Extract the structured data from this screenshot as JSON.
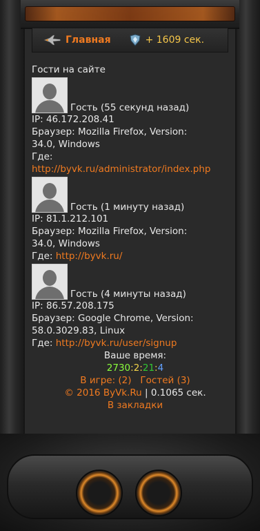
{
  "nav": {
    "home_label": "Главная",
    "bonus_label": "+ 1609 сек.",
    "home_icon": "fighter-jet-icon",
    "bonus_icon": "shield-gem-icon"
  },
  "guests": {
    "heading": "Гости на сайте",
    "items": [
      {
        "name": "Гость (55 секунд назад)",
        "ip": "IP: 46.172.208.41",
        "browser_1": "Браузер: Mozilla Firefox, Version:",
        "browser_2": "34.0, Windows",
        "where_label": "Где:",
        "where_link": "http://byvk.ru/administrator/index.php"
      },
      {
        "name": "Гость (1 минуту назад)",
        "ip": "IP: 81.1.212.101",
        "browser_1": "Браузер: Mozilla Firefox, Version:",
        "browser_2": "34.0, Windows",
        "where_label": "Где:",
        "where_link": "http://byvk.ru/"
      },
      {
        "name": "Гость (4 минуты назад)",
        "ip": "IP: 86.57.208.175",
        "browser_1": "Браузер: Google Chrome, Version:",
        "browser_2": "58.0.3029.83, Linux",
        "where_label": "Где:",
        "where_link": "http://byvk.ru/user/signup"
      }
    ]
  },
  "footer": {
    "your_time_label": "Ваше время:",
    "time": {
      "a": "2730",
      "sep1": ":",
      "b": "2",
      "sep2": ":",
      "c": "21",
      "sep3": ":",
      "d": "4"
    },
    "in_game": "В игре: (2)",
    "guests_count": "Гостей (3)",
    "copyright": "© 2016 ByVk.Ru",
    "separator": "|",
    "gen_time": "0.1065 сек.",
    "bookmarks": "В закладки"
  },
  "colors": {
    "accent": "#f07a20",
    "bonus": "#f5c64a",
    "background": "#2a2a2a"
  }
}
